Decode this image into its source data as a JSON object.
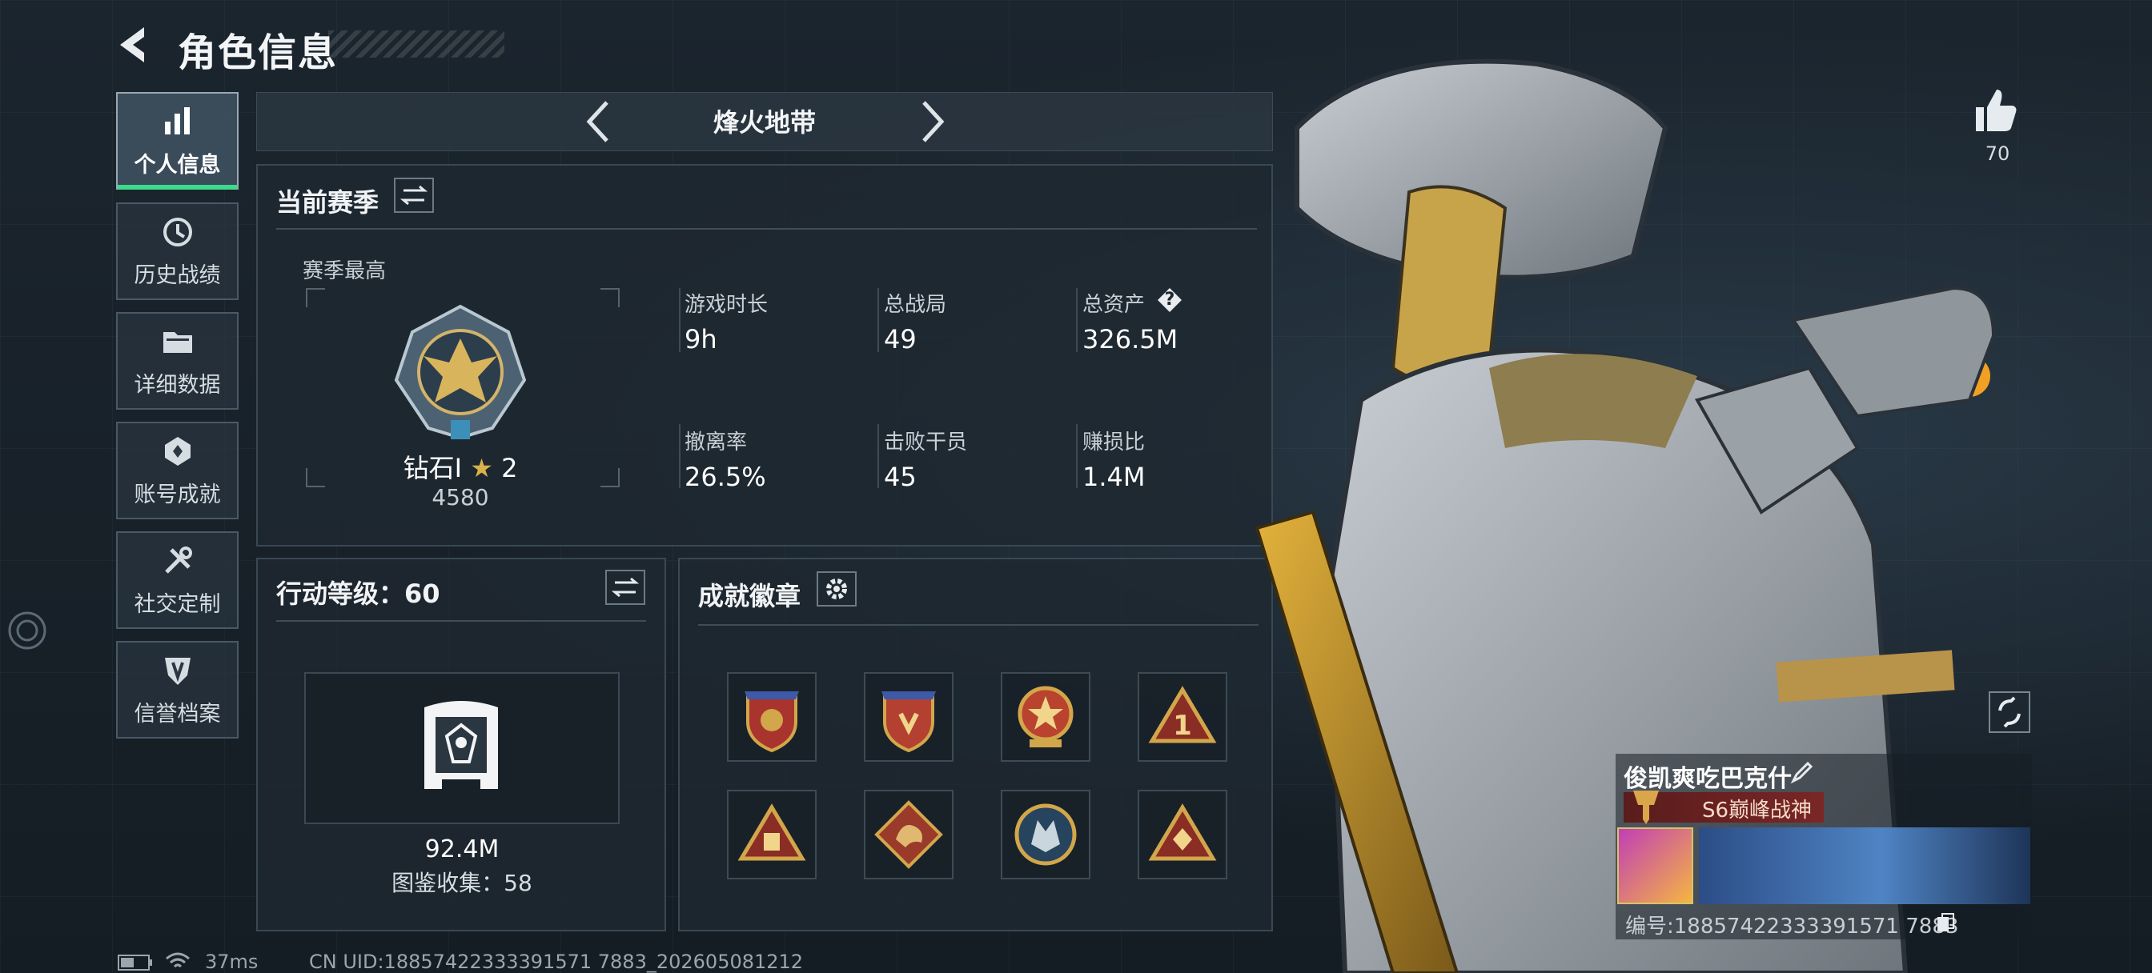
{
  "header": {
    "title": "角色信息"
  },
  "sidebar": {
    "items": [
      {
        "label": "个人信息",
        "icon": "bar-chart-icon",
        "active": true
      },
      {
        "label": "历史战绩",
        "icon": "history-clock-icon"
      },
      {
        "label": "详细数据",
        "icon": "folder-icon"
      },
      {
        "label": "账号成就",
        "icon": "achievement-icon"
      },
      {
        "label": "社交定制",
        "icon": "tools-icon"
      },
      {
        "label": "信誉档案",
        "icon": "credit-shield-icon"
      }
    ]
  },
  "mode": {
    "title": "烽火地带"
  },
  "season": {
    "title": "当前赛季",
    "subtitle": "赛季最高",
    "rank_name": "钻石Ⅰ",
    "rank_stars": "2",
    "rank_points": "4580",
    "stats": [
      {
        "label": "游戏时长",
        "value": "9h"
      },
      {
        "label": "总战局",
        "value": "49"
      },
      {
        "label": "总资产",
        "value": "326.5M"
      },
      {
        "label": "撤离率",
        "value": "26.5%"
      },
      {
        "label": "击败干员",
        "value": "45"
      },
      {
        "label": "赚损比",
        "value": "1.4M"
      }
    ],
    "help_glyph": "?"
  },
  "action_level": {
    "title": "行动等级：60",
    "value": "92.4M",
    "collection": "图鉴收集：58"
  },
  "badges": {
    "title": "成就徽章",
    "items": [
      "shield-badge-1",
      "shield-badge-2",
      "star-medal-badge",
      "triangle-1-badge",
      "triangle-chip-badge",
      "dragon-diamond-badge",
      "wolf-circle-badge",
      "triangle-emblem-badge"
    ]
  },
  "profile": {
    "likes": "70",
    "player_name": "俊凯爽吃巴克什",
    "rank_title": "S6巅峰战神",
    "card_id": "编号:18857422333391571 7883"
  },
  "status_bar": {
    "ping": "37ms",
    "uid": "CN UID:18857422333391571 7883_202605081212"
  },
  "colors": {
    "accent_green": "#3ed98b",
    "gold_star": "#d9b24a",
    "rank_red": "#7a2626"
  }
}
